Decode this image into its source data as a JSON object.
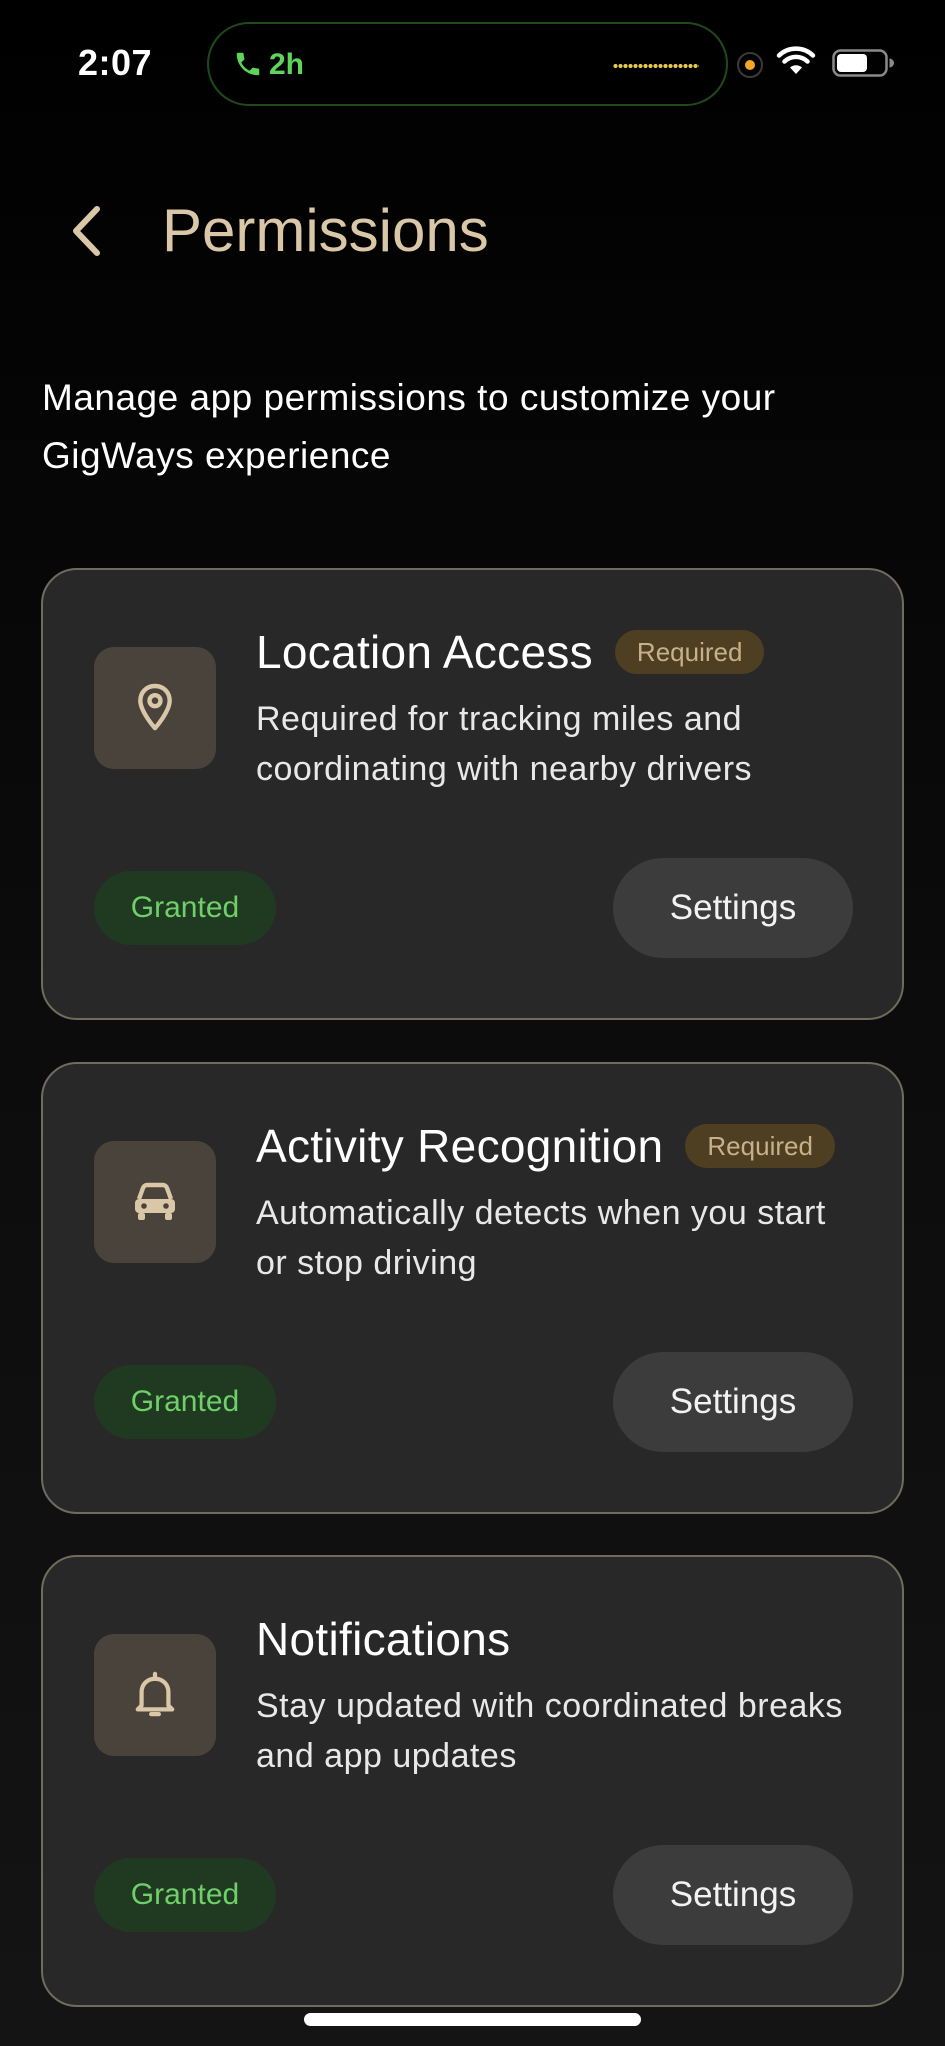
{
  "status_bar": {
    "time": "2:07",
    "call_duration": "2h",
    "colors": {
      "call_green": "#5fd45a",
      "privacy_orange": "#f5a623"
    }
  },
  "header": {
    "back_icon": "chevron-left-icon",
    "title": "Permissions"
  },
  "intro": "Manage app permissions to customize your GigWays experience",
  "permissions": [
    {
      "icon": "location-pin-icon",
      "title": "Location Access",
      "required_label": "Required",
      "description": "Required for tracking miles and coordinating with nearby drivers",
      "status": "Granted",
      "settings_label": "Settings"
    },
    {
      "icon": "car-icon",
      "title": "Activity Recognition",
      "required_label": "Required",
      "description": "Automatically detects when you start or stop driving",
      "status": "Granted",
      "settings_label": "Settings"
    },
    {
      "icon": "bell-icon",
      "title": "Notifications",
      "description": "Stay updated with coordinated breaks and app updates",
      "status": "Granted",
      "settings_label": "Settings"
    }
  ],
  "colors": {
    "title_accent": "#d9c7a8",
    "card_background": "#282828",
    "card_border": "#6f6b5d",
    "granted_text": "#6fd06a",
    "granted_background": "#203a21",
    "required_background": "#4f3f22",
    "required_text": "#c8b088"
  }
}
